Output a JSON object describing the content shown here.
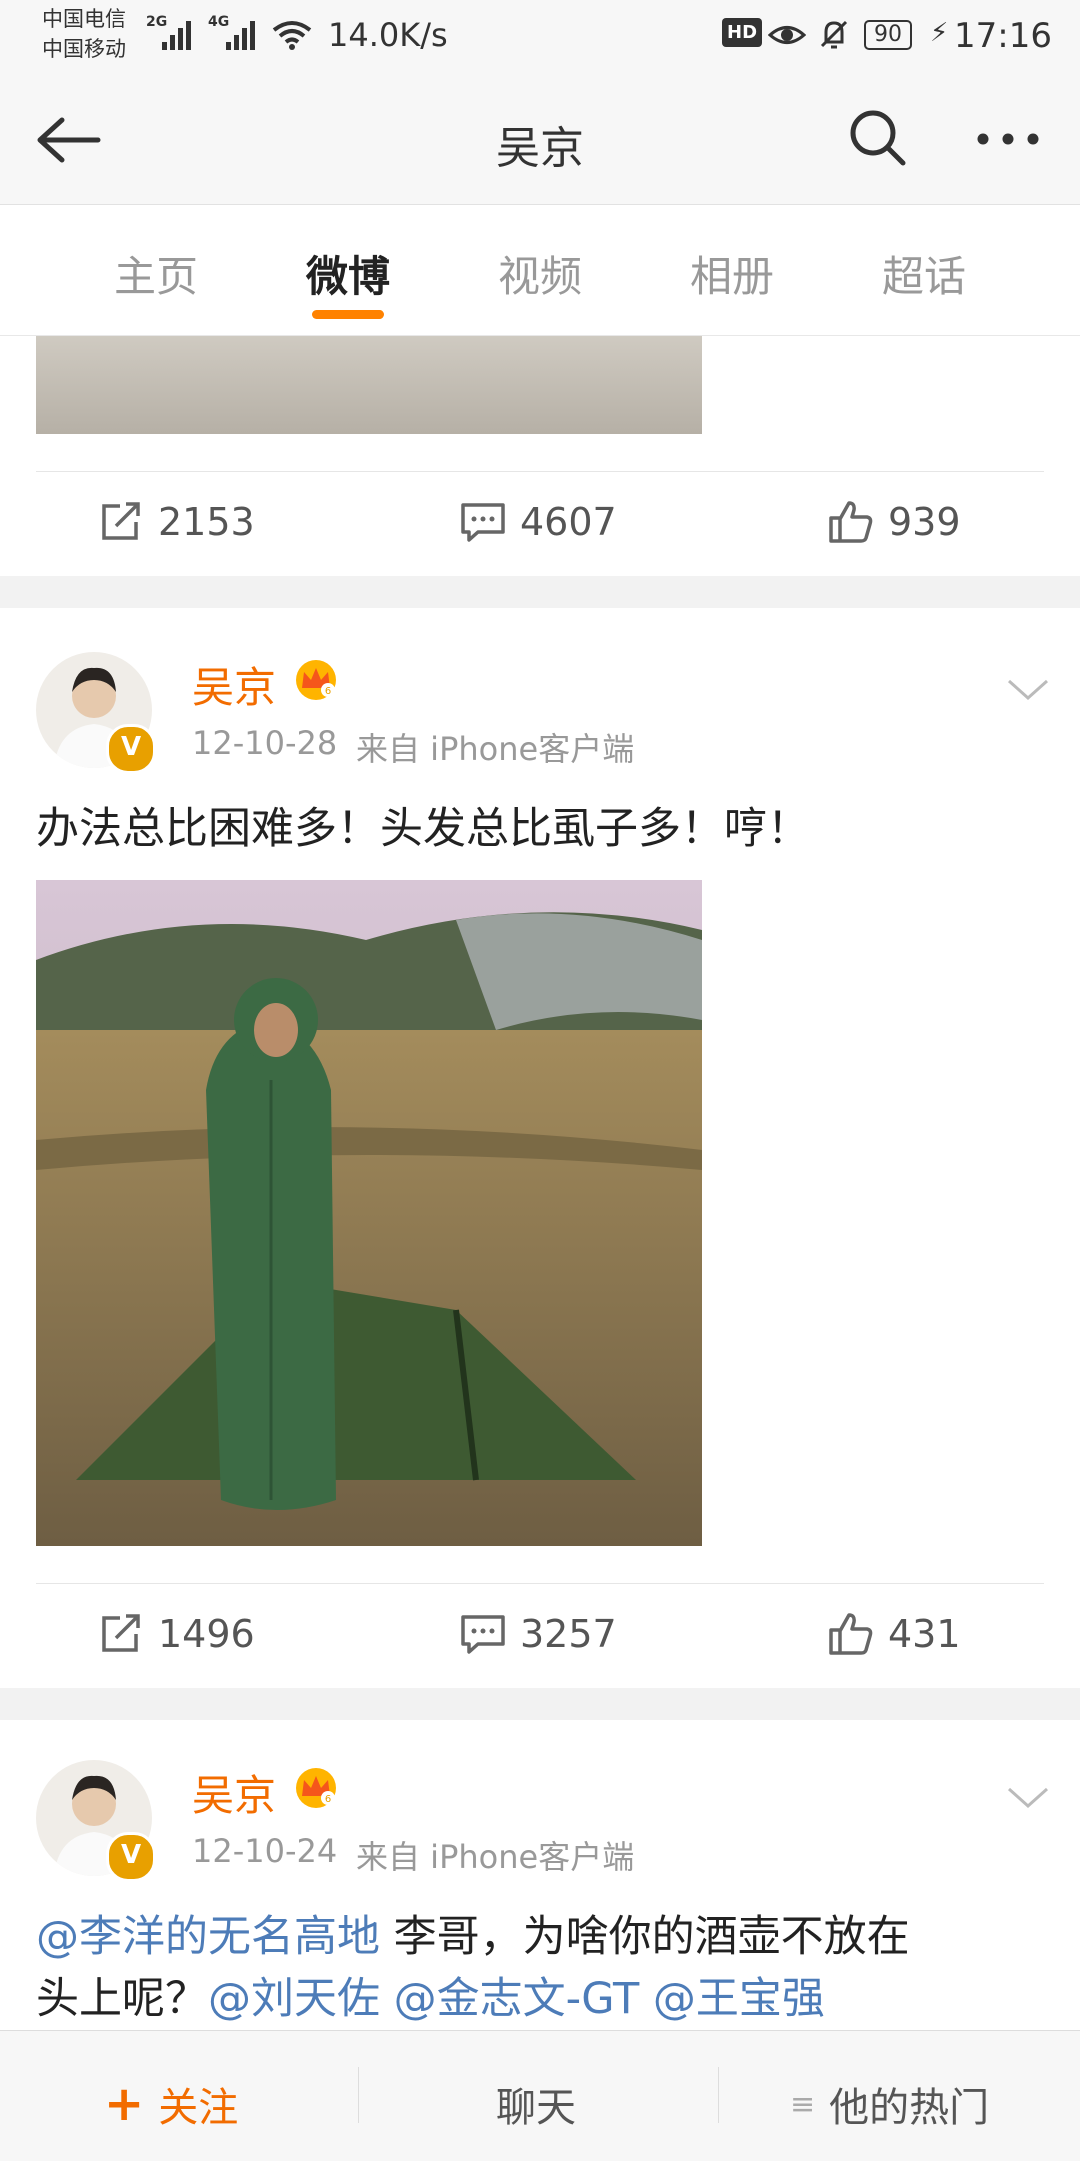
{
  "status_bar": {
    "carrier1": "中国电信",
    "carrier2": "中国移动",
    "signal1": "2G",
    "signal2": "4G",
    "speed": "14.0K/s",
    "hd": "HD",
    "battery": "90",
    "time": "17:16"
  },
  "nav": {
    "title": "吴京"
  },
  "tabs": [
    "主页",
    "微博",
    "视频",
    "相册",
    "超话"
  ],
  "active_tab": "微博",
  "posts": [
    {
      "stats": {
        "repost": "2153",
        "comment": "4607",
        "like": "939"
      }
    },
    {
      "username": "吴京",
      "date": "12-10-28",
      "source": "来自 iPhone客户端",
      "text": "办法总比困难多！头发总比虱子多！哼！",
      "stats": {
        "repost": "1496",
        "comment": "3257",
        "like": "431"
      }
    },
    {
      "username": "吴京",
      "date": "12-10-24",
      "source": "来自 iPhone客户端",
      "mention1": "@李洋的无名高地",
      "text_mid": " 李哥，为啥你的酒壶不放在",
      "text_line2": "头上呢？",
      "mention2": "@刘天佐",
      "mention3": "@金志文-GT",
      "mention4": "@王宝强"
    }
  ],
  "bottom_bar": {
    "follow": "关注",
    "chat": "聊天",
    "hot": "他的热门"
  },
  "colors": {
    "accent": "#ff8200",
    "mention": "#4d7cb8",
    "username": "#f26c00"
  }
}
